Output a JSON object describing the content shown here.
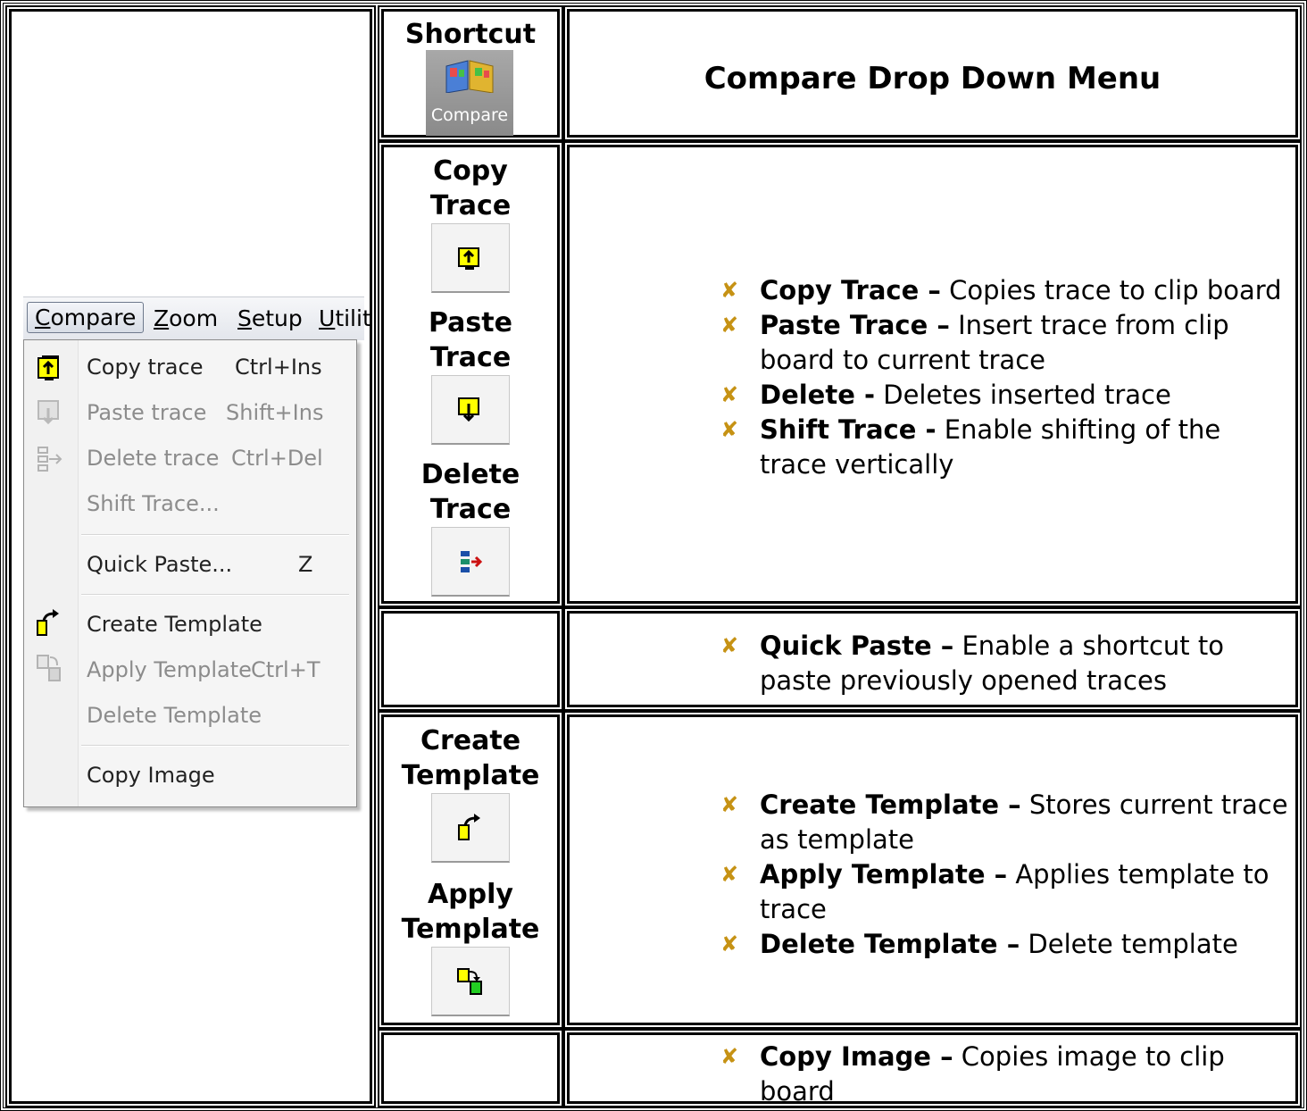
{
  "header": {
    "shortcut_label": "Shortcut",
    "compare_icon_label": "Compare",
    "title": "Compare Drop Down Menu"
  },
  "menu": {
    "bar": [
      "Compare",
      "Zoom",
      "Setup",
      "Utilit"
    ],
    "items": [
      {
        "label": "Copy trace",
        "shortcut": "Ctrl+Ins",
        "enabled": true,
        "icon": "copy-trace-icon"
      },
      {
        "label": "Paste trace",
        "shortcut": "Shift+Ins",
        "enabled": false,
        "icon": "paste-trace-icon"
      },
      {
        "label": "Delete trace",
        "shortcut": "Ctrl+Del",
        "enabled": false,
        "icon": "delete-trace-icon"
      },
      {
        "label": "Shift Trace...",
        "shortcut": "",
        "enabled": false,
        "icon": ""
      },
      {
        "label": "Quick Paste...",
        "shortcut": "Z",
        "enabled": true,
        "icon": ""
      },
      {
        "label": "Create Template",
        "shortcut": "",
        "enabled": true,
        "icon": "create-template-icon"
      },
      {
        "label": "Apply Template",
        "shortcut": "Ctrl+T",
        "enabled": false,
        "icon": "apply-template-icon"
      },
      {
        "label": "Delete Template",
        "shortcut": "",
        "enabled": false,
        "icon": ""
      },
      {
        "label": "Copy Image",
        "shortcut": "",
        "enabled": true,
        "icon": ""
      }
    ]
  },
  "shortcuts": {
    "copy_trace": [
      "Copy",
      "Trace"
    ],
    "paste_trace": [
      "Paste",
      "Trace"
    ],
    "delete_trace": [
      "Delete",
      "Trace"
    ],
    "create_template": [
      "Create",
      "Template"
    ],
    "apply_template": [
      "Apply",
      "Template"
    ]
  },
  "descriptions": {
    "trace": [
      {
        "term": "Copy Trace –",
        "text": " Copies trace to clip board"
      },
      {
        "term": "Paste Trace –",
        "text": " Insert trace from clip board to current trace"
      },
      {
        "term": "Delete -",
        "text": "  Deletes inserted trace"
      },
      {
        "term": "Shift Trace -",
        "text": "  Enable shifting of the trace vertically"
      }
    ],
    "quick": [
      {
        "term": "Quick Paste –",
        "text": " Enable a shortcut to paste previously opened traces"
      }
    ],
    "template": [
      {
        "term": "Create Template –",
        "text": " Stores current trace as template"
      },
      {
        "term": "Apply Template –",
        "text": " Applies template to trace"
      },
      {
        "term": "Delete Template –",
        "text": " Delete template"
      }
    ],
    "image": [
      {
        "term": "Copy Image –",
        "text": " Copies image to clip board"
      }
    ]
  },
  "bullet_glyph": "x",
  "colors": {
    "bullet": "#c69214",
    "icon_yellow": "#ffff00",
    "icon_green": "#22cc22"
  }
}
